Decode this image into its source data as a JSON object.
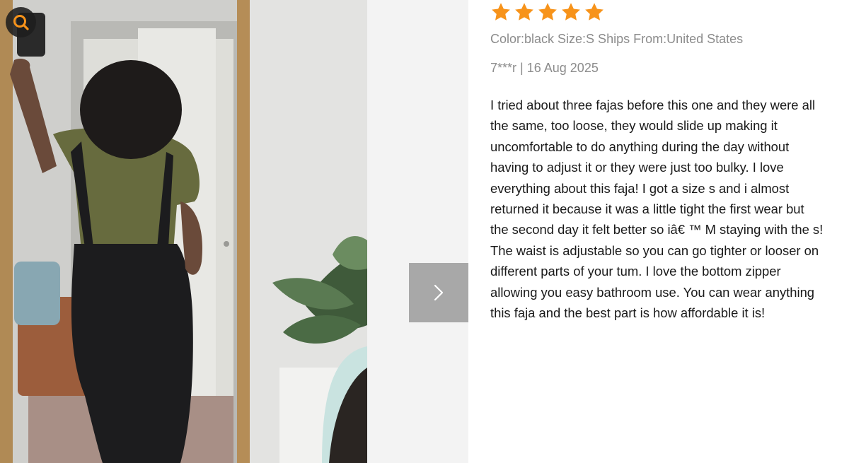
{
  "photo": {
    "zoom_icon": "search-icon",
    "next_icon": "chevron-right-icon"
  },
  "review": {
    "rating": 5,
    "star_color": "#f7931a",
    "meta": "Color:black Size:S Ships From:United States",
    "author": "7***r",
    "separator": "|",
    "date": "16 Aug 2025",
    "body": "I tried about three fajas before this one and they were all the same, too loose, they would slide up making it uncomfortable to do anything during the day without having to adjust it or they were just too bulky. I love everything about this faja! I got a size s and i almost returned it because it was a little tight the first wear but the second day it felt better so iâ€ ™ M staying with the s! The waist is adjustable so you can go tighter or looser on different parts of your tum. I love the bottom zipper allowing you easy bathroom use. You can wear anything this faja and the best part is how affordable it is!"
  },
  "colors": {
    "accent": "#f7931a",
    "meta_text": "#8c8c8c",
    "body_text": "#1a1a1a",
    "nav_button": "#a8a8a8"
  }
}
